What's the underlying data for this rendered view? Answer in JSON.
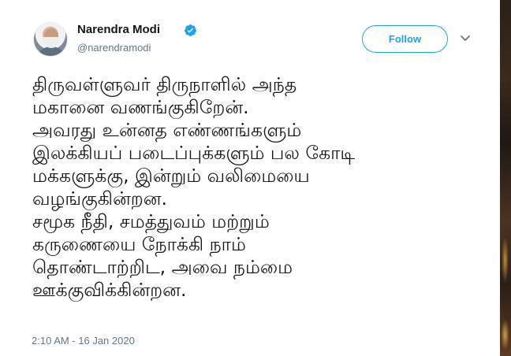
{
  "author": {
    "name": "Narendra Modi",
    "handle": "@narendramodi",
    "verified": true
  },
  "follow_button": {
    "label": "Follow"
  },
  "menu": {
    "icon": "chevron-down-icon"
  },
  "tweet": {
    "lines": [
      "திருவள்ளுவர் திருநாளில் அந்த",
      "மகானை வணங்குகிறேன்.",
      "அவரது உன்னத எண்ணங்களும்",
      "இலக்கியப் படைப்புக்களும் பல கோடி",
      "மக்களுக்கு, இன்றும் வலிமையை",
      "வழங்குகின்றன.",
      "சமூக நீதி,  சமத்துவம் மற்றும்",
      "கருணையை நோக்கி நாம்",
      "தொண்டாற்றிட, அவை நம்மை",
      "ஊக்குவிக்கின்றன."
    ],
    "timestamp": "2:10 AM - 16 Jan 2020"
  },
  "colors": {
    "accent": "#1da1f2",
    "text": "#14171a",
    "secondary": "#657786"
  }
}
